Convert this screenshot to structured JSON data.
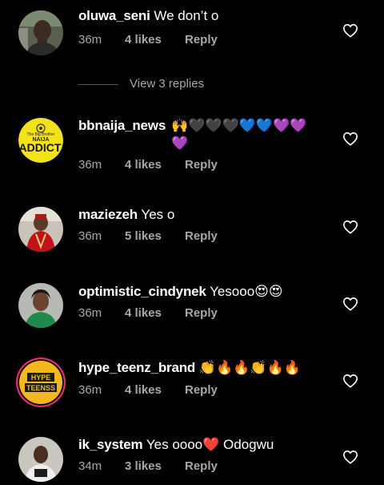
{
  "comments": [
    {
      "username": "oluwa_seni",
      "text": "We don’t o",
      "time": "36m",
      "likes": "4 likes",
      "reply": "Reply"
    },
    {
      "username": "bbnaija_news",
      "text": "🙌🖤🖤🖤💙💙💜💜💜",
      "time": "36m",
      "likes": "4 likes",
      "reply": "Reply",
      "avatar_text_1": "The Big Brother",
      "avatar_text_2": "NAIJA",
      "avatar_text_3": "ADDICT"
    },
    {
      "username": "maziezeh",
      "text": "Yes o",
      "time": "36m",
      "likes": "5 likes",
      "reply": "Reply"
    },
    {
      "username": "optimistic_cindynek",
      "text": "Yesooo😍😍",
      "time": "36m",
      "likes": "4 likes",
      "reply": "Reply"
    },
    {
      "username": "hype_teenz_brand",
      "text": "👏🔥🔥👏🔥🔥",
      "time": "36m",
      "likes": "4 likes",
      "reply": "Reply",
      "avatar_text_1": "HYPE",
      "avatar_text_2": "TEENSS"
    },
    {
      "username": "ik_system",
      "text": "Yes oooo❤️ Odogwu",
      "time": "34m",
      "likes": "3 likes",
      "reply": "Reply"
    }
  ],
  "view_replies": "View 3 replies",
  "icons": {
    "like": "heart-outline-icon"
  },
  "colors": {
    "background": "#000000",
    "text": "#ffffff",
    "meta": "#a8a8a8"
  }
}
